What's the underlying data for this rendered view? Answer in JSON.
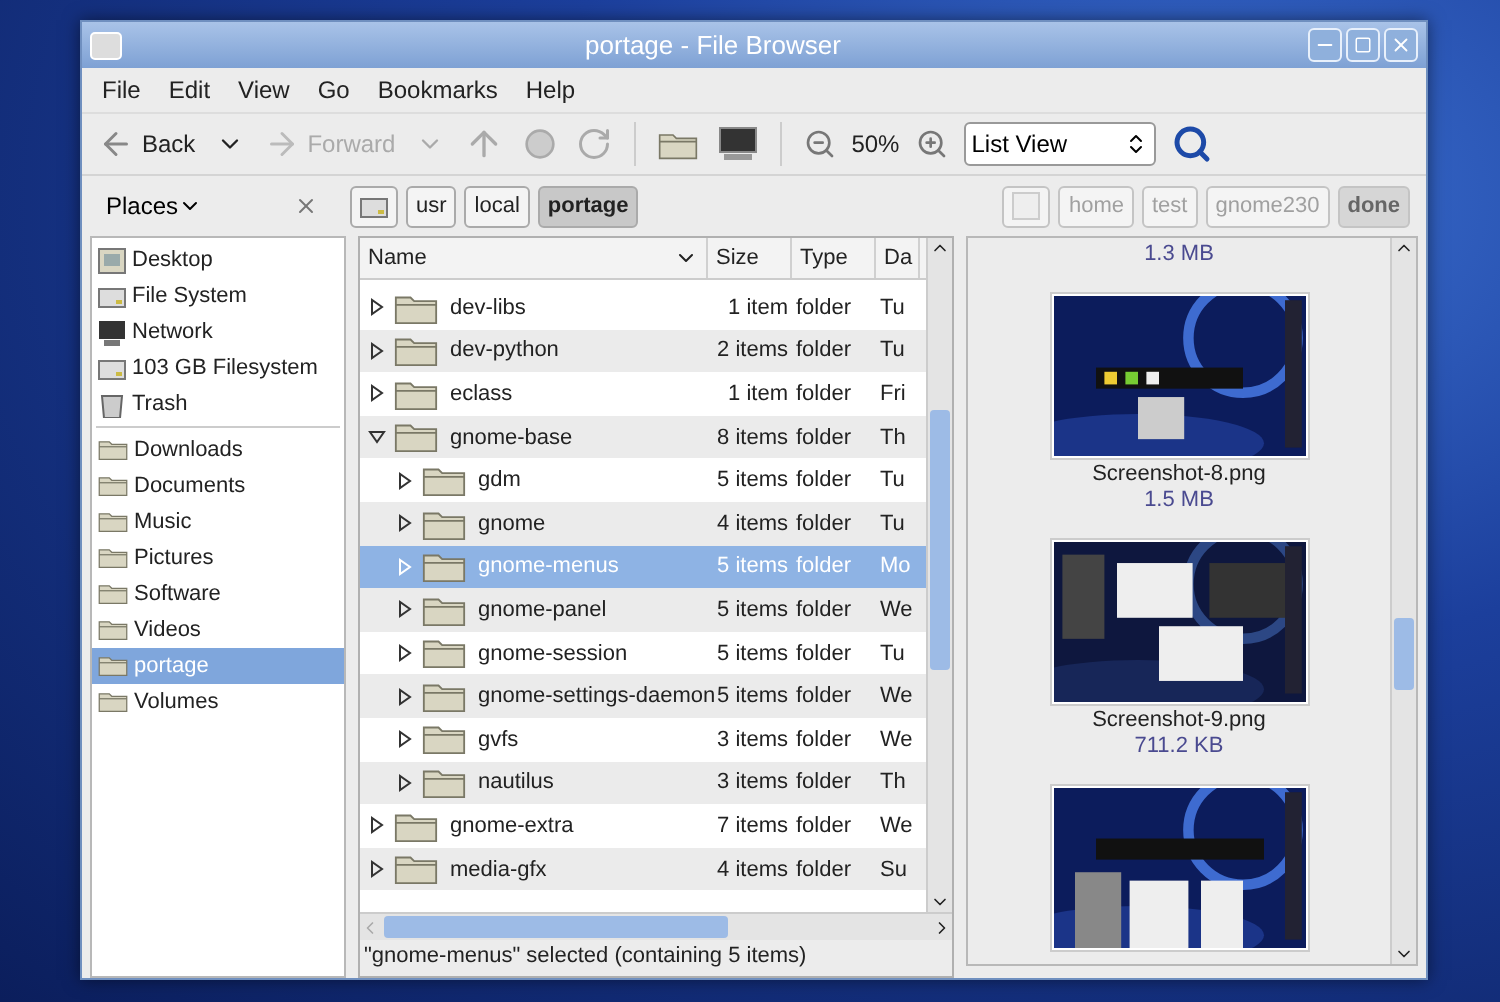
{
  "window": {
    "title": "portage - File Browser"
  },
  "menu": [
    "File",
    "Edit",
    "View",
    "Go",
    "Bookmarks",
    "Help"
  ],
  "toolbar": {
    "back": {
      "label": "Back",
      "disabled": false
    },
    "forward": {
      "label": "Forward",
      "disabled": true
    },
    "zoom": "50%",
    "view": "List View"
  },
  "places": {
    "label": "Places"
  },
  "path": [
    {
      "kind": "icon",
      "selected": false
    },
    {
      "kind": "text",
      "label": "usr",
      "selected": false
    },
    {
      "kind": "text",
      "label": "local",
      "selected": false
    },
    {
      "kind": "text",
      "label": "portage",
      "selected": true
    }
  ],
  "history": [
    {
      "kind": "icon",
      "selected": false,
      "disabled": true
    },
    {
      "kind": "text",
      "label": "home",
      "selected": false,
      "disabled": true
    },
    {
      "kind": "text",
      "label": "test",
      "selected": false,
      "disabled": true
    },
    {
      "kind": "text",
      "label": "gnome230",
      "selected": false,
      "disabled": true
    },
    {
      "kind": "text",
      "label": "done",
      "selected": true,
      "disabled": true
    }
  ],
  "sidebar": [
    [
      {
        "label": "Desktop",
        "kind": "desktop",
        "selected": false
      },
      {
        "label": "File System",
        "kind": "drive",
        "selected": false
      },
      {
        "label": "Network",
        "kind": "network",
        "selected": false
      },
      {
        "label": "103 GB Filesystem",
        "kind": "drive",
        "selected": false
      },
      {
        "label": "Trash",
        "kind": "trash",
        "selected": false
      }
    ],
    [
      {
        "label": "Downloads",
        "kind": "folder",
        "selected": false
      },
      {
        "label": "Documents",
        "kind": "folder",
        "selected": false
      },
      {
        "label": "Music",
        "kind": "folder",
        "selected": false
      },
      {
        "label": "Pictures",
        "kind": "folder",
        "selected": false
      },
      {
        "label": "Software",
        "kind": "folder",
        "selected": false
      },
      {
        "label": "Videos",
        "kind": "folder",
        "selected": false
      },
      {
        "label": "portage",
        "kind": "folder",
        "selected": true
      },
      {
        "label": "Volumes",
        "kind": "folder",
        "selected": false
      }
    ]
  ],
  "table": {
    "columns": [
      "Name",
      "Size",
      "Type",
      "Da"
    ],
    "rows": [
      {
        "name": "dev-libs",
        "size": "1 item",
        "type": "folder",
        "date": "Tu",
        "expanded": false,
        "selected": false
      },
      {
        "name": "dev-python",
        "size": "2 items",
        "type": "folder",
        "date": "Tu",
        "expanded": false,
        "selected": false
      },
      {
        "name": "eclass",
        "size": "1 item",
        "type": "folder",
        "date": "Fri",
        "expanded": false,
        "selected": false
      },
      {
        "name": "gnome-base",
        "size": "8 items",
        "type": "folder",
        "date": "Th",
        "expanded": true,
        "selected": false,
        "children": [
          {
            "name": "gdm",
            "size": "5 items",
            "type": "folder",
            "date": "Tu",
            "expanded": false,
            "selected": false
          },
          {
            "name": "gnome",
            "size": "4 items",
            "type": "folder",
            "date": "Tu",
            "expanded": false,
            "selected": false
          },
          {
            "name": "gnome-menus",
            "size": "5 items",
            "type": "folder",
            "date": "Mo",
            "expanded": false,
            "selected": true
          },
          {
            "name": "gnome-panel",
            "size": "5 items",
            "type": "folder",
            "date": "We",
            "expanded": false,
            "selected": false
          },
          {
            "name": "gnome-session",
            "size": "5 items",
            "type": "folder",
            "date": "Tu",
            "expanded": false,
            "selected": false
          },
          {
            "name": "gnome-settings-daemon",
            "size": "5 items",
            "type": "folder",
            "date": "We",
            "expanded": false,
            "selected": false
          },
          {
            "name": "gvfs",
            "size": "3 items",
            "type": "folder",
            "date": "We",
            "expanded": false,
            "selected": false
          },
          {
            "name": "nautilus",
            "size": "3 items",
            "type": "folder",
            "date": "Th",
            "expanded": false,
            "selected": false
          }
        ]
      },
      {
        "name": "gnome-extra",
        "size": "7 items",
        "type": "folder",
        "date": "We",
        "expanded": false,
        "selected": false
      },
      {
        "name": "media-gfx",
        "size": "4 items",
        "type": "folder",
        "date": "Su",
        "expanded": false,
        "selected": false
      }
    ]
  },
  "preview": [
    {
      "size": "1.3 MB"
    },
    {
      "kind": "picture",
      "name": "Screenshot-8.png",
      "size": "1.5 MB"
    },
    {
      "kind": "picture",
      "name": "Screenshot-9.png",
      "size": "711.2 KB"
    },
    {
      "kind": "picture"
    }
  ],
  "status_bar": "\"gnome-menus\" selected (containing 5 items)"
}
